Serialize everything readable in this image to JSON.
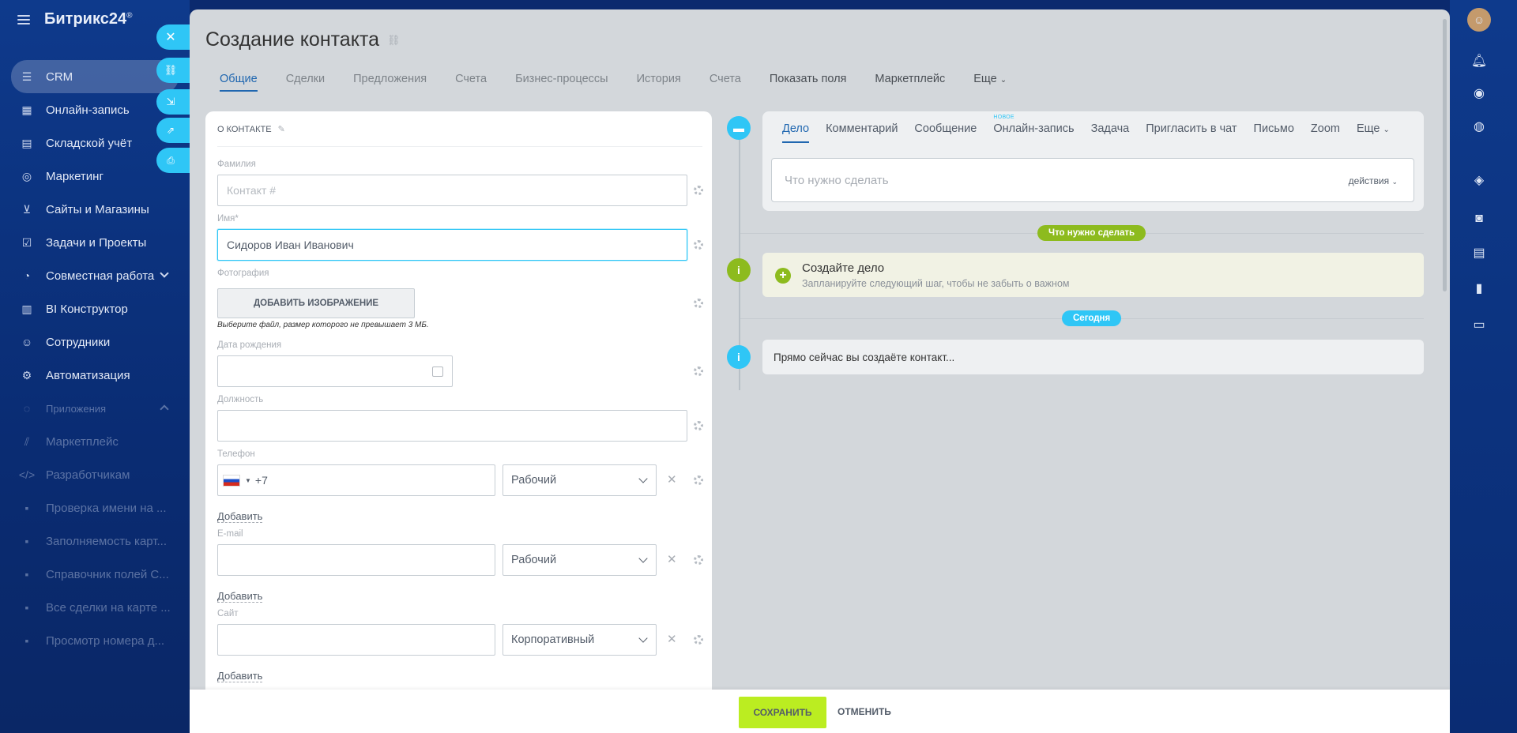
{
  "app": {
    "logo": "Битрикс24",
    "logo_mark": "®"
  },
  "sidebar": {
    "items": [
      {
        "label": "CRM",
        "icon": "crm-filter-icon",
        "active": true
      },
      {
        "label": "Онлайн-запись",
        "icon": "calendar-icon"
      },
      {
        "label": "Складской учёт",
        "icon": "warehouse-icon"
      },
      {
        "label": "Маркетинг",
        "icon": "target-icon"
      },
      {
        "label": "Сайты и Магазины",
        "icon": "cart-icon"
      },
      {
        "label": "Задачи и Проекты",
        "icon": "checkbox-icon"
      },
      {
        "label": "Совместная работа",
        "icon": "chat-bubble-icon"
      },
      {
        "label": "BI Конструктор",
        "icon": "bar-chart-icon"
      },
      {
        "label": "Сотрудники",
        "icon": "people-icon"
      },
      {
        "label": "Автоматизация",
        "icon": "automation-icon"
      },
      {
        "label": "Приложения",
        "icon": "apps-icon"
      },
      {
        "label": "Маркетплейс",
        "icon": "market-icon"
      },
      {
        "label": "Разработчикам",
        "icon": "code-icon"
      },
      {
        "label": "Проверка имени на ...",
        "icon": "app-badge-icon"
      },
      {
        "label": "Заполняемость карт...",
        "icon": "app-badge-icon"
      },
      {
        "label": "Справочник полей С...",
        "icon": "app-badge-icon"
      },
      {
        "label": "Все сделки на карте ...",
        "icon": "map-icon"
      },
      {
        "label": "Просмотр номера д...",
        "icon": "phone-icon"
      }
    ]
  },
  "slider": {
    "title": "Создание контакта",
    "tabs": [
      {
        "label": "Общие",
        "active": true
      },
      {
        "label": "Сделки"
      },
      {
        "label": "Предложения"
      },
      {
        "label": "Счета"
      },
      {
        "label": "Бизнес-процессы"
      },
      {
        "label": "История"
      },
      {
        "label": "Счета"
      },
      {
        "label": "Показать поля",
        "strong": true
      },
      {
        "label": "Маркетплейс",
        "strong": true
      },
      {
        "label": "Еще",
        "strong": true
      }
    ]
  },
  "form": {
    "section_title": "О КОНТАКТЕ",
    "lastname_label": "Фамилия",
    "lastname_placeholder": "Контакт #",
    "name_label": "Имя*",
    "name_value": "Сидоров Иван Иванович",
    "photo_label": "Фотография",
    "photo_button": "ДОБАВИТЬ ИЗОБРАЖЕНИЕ",
    "photo_hint": "Выберите файл, размер которого не превышает 3 МБ.",
    "birthdate_label": "Дата рождения",
    "position_label": "Должность",
    "phone_label": "Телефон",
    "phone_prefix": "+7",
    "phone_type": "Рабочий",
    "add_link": "Добавить",
    "email_label": "E-mail",
    "email_type": "Рабочий",
    "site_label": "Сайт",
    "site_type": "Корпоративный"
  },
  "timeline": {
    "editor_tabs": [
      {
        "label": "Дело",
        "active": true
      },
      {
        "label": "Комментарий"
      },
      {
        "label": "Сообщение"
      },
      {
        "label": "Онлайн-запись",
        "badge": "НОВОЕ"
      },
      {
        "label": "Задача"
      },
      {
        "label": "Пригласить в чат"
      },
      {
        "label": "Письмо"
      },
      {
        "label": "Zoom"
      },
      {
        "label": "Еще"
      }
    ],
    "editor_placeholder": "Что нужно сделать",
    "editor_actions": "действия",
    "todo_pill": "Что нужно сделать",
    "create_title": "Создайте дело",
    "create_subtitle": "Запланируйте следующий шаг, чтобы не забыть о важном",
    "today_pill": "Сегодня",
    "info_text": "Прямо сейчас вы создаёте контакт..."
  },
  "footer": {
    "save": "СОХРАНИТЬ",
    "cancel": "ОТМЕНИТЬ"
  },
  "colors": {
    "accent": "#2067b0",
    "save": "#bbed21",
    "pill_green": "#8dbb1e",
    "pill_blue": "#2fc6f6",
    "sidebar": "#0e3a8c"
  }
}
